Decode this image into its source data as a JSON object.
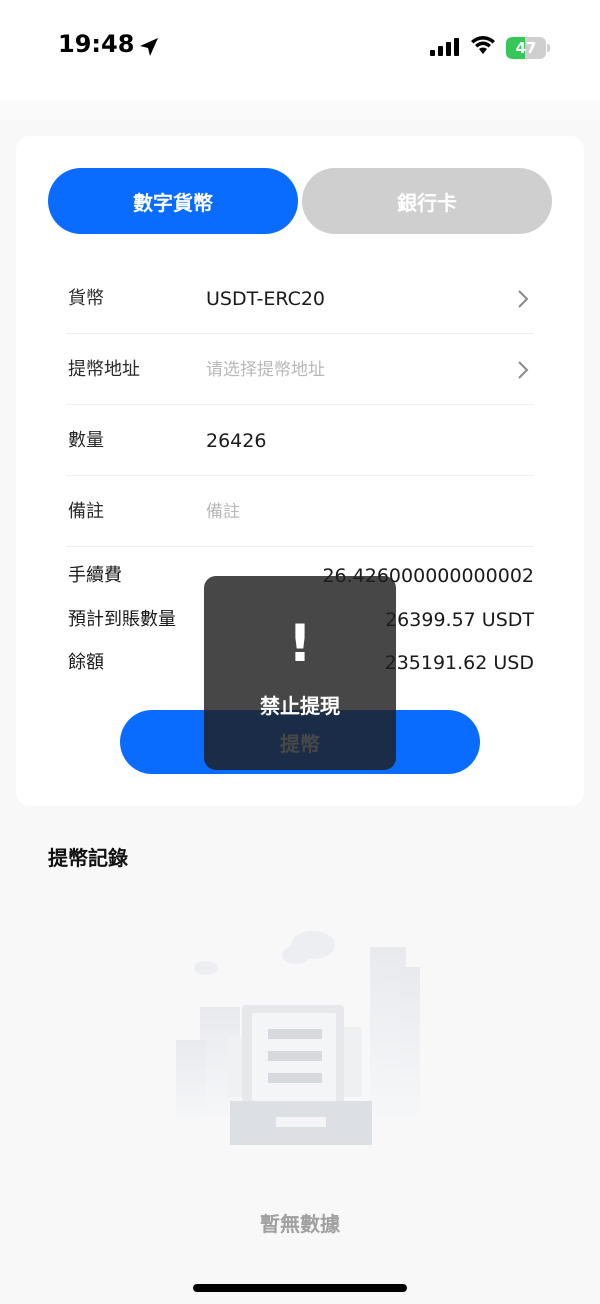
{
  "status_bar": {
    "time": "19:48",
    "battery": "47",
    "battery_level": 0.47,
    "icons": [
      "location-arrow-icon",
      "signal-icon",
      "wifi-icon",
      "battery-icon"
    ]
  },
  "tabs": {
    "crypto_label": "數字貨幣",
    "bank_label": "銀行卡",
    "active": "crypto"
  },
  "form": {
    "currency": {
      "label": "貨幣",
      "value": "USDT-ERC20"
    },
    "address": {
      "label": "提幣地址",
      "placeholder": "请选择提幣地址"
    },
    "amount": {
      "label": "數量",
      "value": "26426"
    },
    "note": {
      "label": "備註",
      "placeholder": "備註"
    }
  },
  "summary": {
    "fee_label": "手續費",
    "fee_value": "26.426000000000002",
    "expected_label": "預計到賬數量",
    "expected_value": "26399.57 USDT",
    "balance_label": "餘額",
    "balance_value": "235191.62 USD"
  },
  "submit_label": "提幣",
  "toast": {
    "icon": "!",
    "message": "禁止提現"
  },
  "records": {
    "title": "提幣記錄",
    "empty_text": "暫無數據"
  },
  "colors": {
    "primary": "#0a6cff",
    "inactive_tab": "#cfcfcf",
    "battery_green": "#34c759"
  }
}
